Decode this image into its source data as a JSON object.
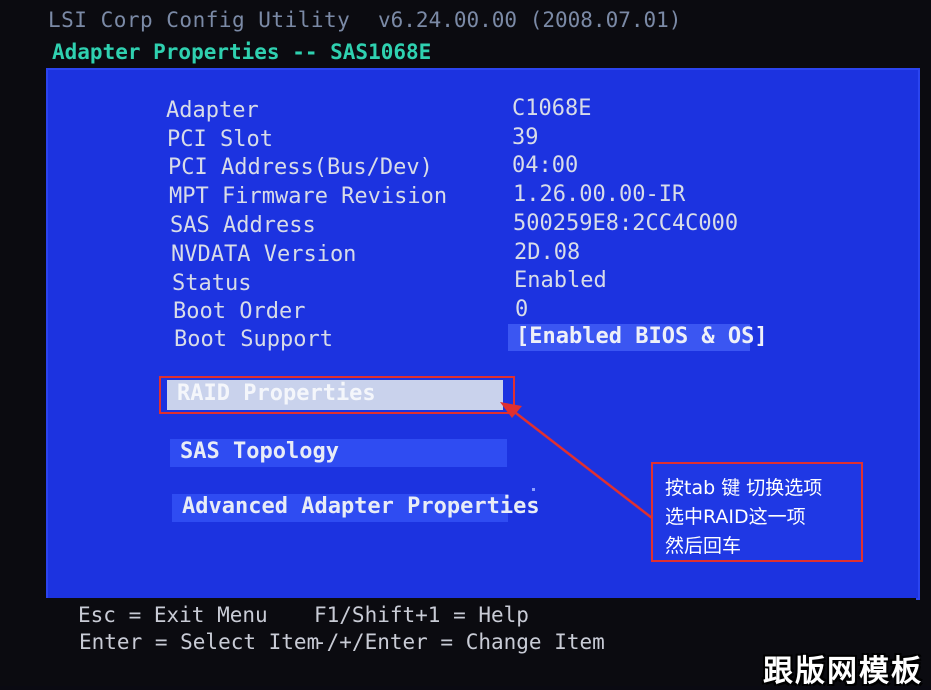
{
  "header": {
    "title": "LSI Corp Config Utility",
    "version": "v6.24.00.00 (2008.07.01)",
    "subtitle": "Adapter Properties -- SAS1068E"
  },
  "properties": [
    {
      "label": "Adapter",
      "value": "C1068E"
    },
    {
      "label": "PCI Slot",
      "value": "39"
    },
    {
      "label": "PCI Address(Bus/Dev)",
      "value": "04:00"
    },
    {
      "label": "MPT Firmware Revision",
      "value": "1.26.00.00-IR"
    },
    {
      "label": "SAS Address",
      "value": "500259E8:2CC4C000"
    },
    {
      "label": "NVDATA Version",
      "value": "2D.08"
    },
    {
      "label": "Status",
      "value": "Enabled"
    },
    {
      "label": "Boot Order",
      "value": "0"
    },
    {
      "label": "Boot Support",
      "value": "[Enabled BIOS & OS]"
    }
  ],
  "menu": {
    "raid_properties": "RAID Properties",
    "sas_topology": "SAS Topology",
    "advanced_adapter_properties": "Advanced Adapter Properties"
  },
  "footer": {
    "esc": "Esc = Exit Menu",
    "f1": "F1/Shift+1 = Help",
    "enter": "Enter = Select Item",
    "change": "-/+/Enter = Change Item"
  },
  "annotation": {
    "line1": "按tab 键 切换选项",
    "line2": "选中RAID这一项",
    "line3": "然后回车"
  },
  "watermark": "跟版网模板",
  "colors": {
    "panel_blue": "#1c33e0",
    "header_teal": "#2fd1b0",
    "annotation_red": "#e03030"
  }
}
